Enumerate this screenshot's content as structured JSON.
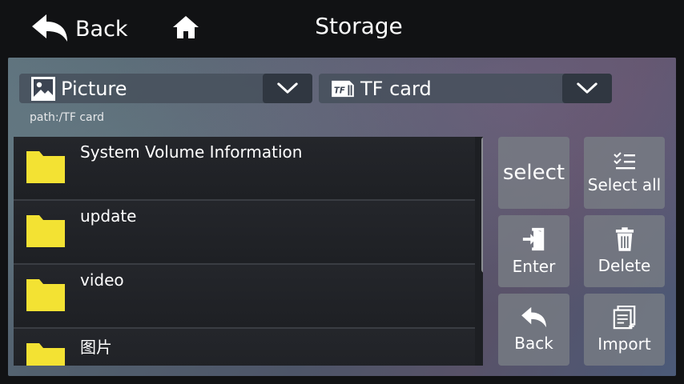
{
  "header": {
    "back_label": "Back",
    "title": "Storage"
  },
  "filters": {
    "type_selected": "Picture",
    "source_selected": "TF card",
    "tf_icon_text": "TF"
  },
  "path_text": "path:/TF card",
  "files": [
    {
      "name": "System Volume Information",
      "icon": "folder-icon"
    },
    {
      "name": "update",
      "icon": "folder-icon"
    },
    {
      "name": "video",
      "icon": "folder-icon"
    },
    {
      "name": "图片",
      "icon": "folder-icon"
    }
  ],
  "actions": {
    "select": "select",
    "select_all": "Select all",
    "enter": "Enter",
    "delete": "Delete",
    "back": "Back",
    "import": "Import"
  },
  "colors": {
    "folder": "#f3e233",
    "header_bg": "#111214",
    "list_bg": "#1d1f23"
  }
}
